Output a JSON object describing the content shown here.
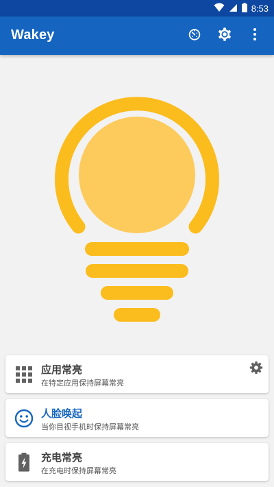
{
  "status_bar": {
    "time": "8:53",
    "icons": [
      "wifi-icon",
      "cellular-signal-icon",
      "battery-icon"
    ]
  },
  "app_bar": {
    "title": "Wakey",
    "actions": [
      "timer-icon",
      "settings-icon",
      "overflow-menu-icon"
    ]
  },
  "colors": {
    "app_bar": "#1565c0",
    "status_bar": "#0d47a1",
    "bulb_outline": "#fbbc1e",
    "bulb_fill": "#fdcb5b",
    "background": "#f2f2f2",
    "active_accent": "#1565c0"
  },
  "modes": [
    {
      "title": "应用常亮",
      "subtitle": "在特定应用保持屏幕常亮",
      "icon": "apps-grid-icon",
      "active": false,
      "has_settings": true
    },
    {
      "title": "人脸唤起",
      "subtitle": "当你目视手机时保持屏幕常亮",
      "icon": "face-icon",
      "active": true,
      "has_settings": false
    },
    {
      "title": "充电常亮",
      "subtitle": "在充电时保持屏幕常亮",
      "icon": "battery-charging-icon",
      "active": false,
      "has_settings": false
    }
  ]
}
